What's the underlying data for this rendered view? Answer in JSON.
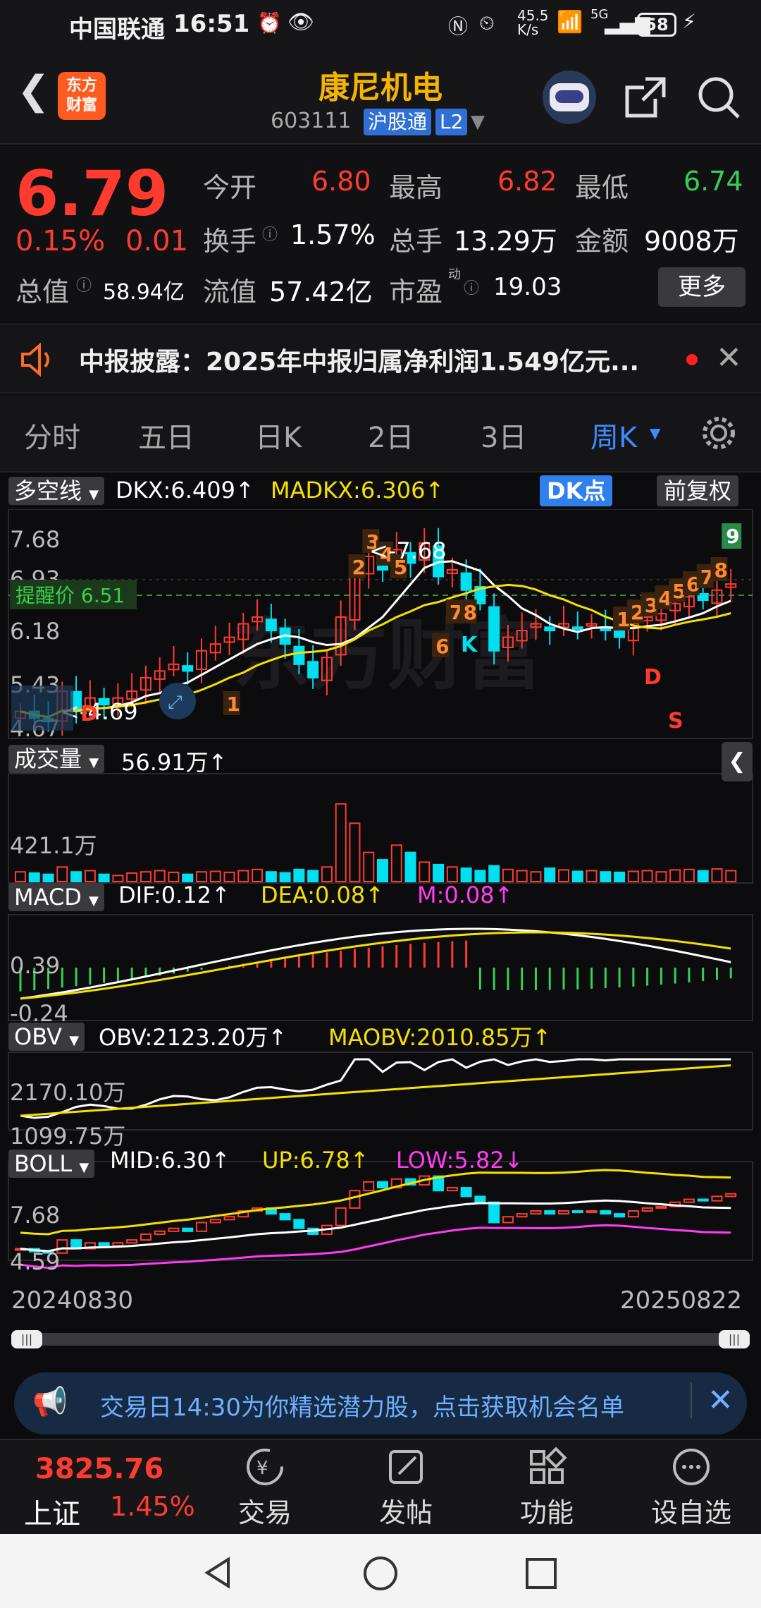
{
  "status": {
    "carrier": "中国联通",
    "time": "16:51",
    "net_speed_top": "45.5",
    "net_speed_unit": "K/s",
    "signal": "5G",
    "battery": "58"
  },
  "header": {
    "logo_line1": "东方",
    "logo_line2": "财富",
    "stock_name": "康尼机电",
    "code": "603111",
    "channel": "沪股通",
    "level": "L2"
  },
  "quote": {
    "price": "6.79",
    "change_pct": "0.15%",
    "change": "0.01",
    "open_label": "今开",
    "open": "6.80",
    "high_label": "最高",
    "high": "6.82",
    "low_label": "最低",
    "low": "6.74",
    "turnover_label": "换手",
    "turnover": "1.57%",
    "volume_label": "总手",
    "volume": "13.29万",
    "amount_label": "金额",
    "amount": "9008万",
    "mktcap_label": "总值",
    "mktcap": "58.94亿",
    "float_label": "流值",
    "float": "57.42亿",
    "pe_label": "市盈",
    "pe_sup": "动",
    "pe": "19.03",
    "more": "更多"
  },
  "notice": {
    "text": "中报披露：2025年中报归属净利润1.549亿元..."
  },
  "tabs": [
    "分时",
    "五日",
    "日K",
    "2日",
    "3日",
    "周K"
  ],
  "kline": {
    "indicator": "多空线",
    "dkx": "DKX:6.409↑",
    "madkx": "MADKX:6.306↑",
    "dk_btn": "DK点",
    "adj_btn": "前复权",
    "y_labels": [
      "7.68",
      "6.93",
      "6.18",
      "5.43",
      "4.67"
    ],
    "alert": "提醒价 6.51",
    "high_mark": "<-7.68",
    "low_mark": "<-4.69",
    "watermark": "东方财富"
  },
  "volume": {
    "label": "成交量",
    "value": "56.91万↑",
    "max": "421.1万"
  },
  "macd": {
    "label": "MACD",
    "dif": "DIF:0.12↑",
    "dea": "DEA:0.08↑",
    "m": "M:0.08↑",
    "top": "0.39",
    "bottom": "-0.24"
  },
  "obv": {
    "label": "OBV",
    "obv": "OBV:2123.20万↑",
    "maobv": "MAOBV:2010.85万↑",
    "top": "2170.10万",
    "bottom": "1099.75万"
  },
  "boll": {
    "label": "BOLL",
    "mid": "MID:6.30↑",
    "up": "UP:6.78↑",
    "low": "LOW:5.82↓",
    "top": "7.68",
    "bottom": "4.59"
  },
  "dates": {
    "start": "20240830",
    "end": "20250822"
  },
  "ad": {
    "text": "交易日14:30为你精选潜力股，点击获取机会名单"
  },
  "bottomnav": {
    "index_value": "3825.76",
    "index_name": "上证",
    "index_pct": "1.45%",
    "trade": "交易",
    "post": "发帖",
    "func": "功能",
    "watch": "设自选"
  },
  "colors": {
    "up": "#ff3b30",
    "down": "#00e0f0",
    "accent": "#2f80ed",
    "yellow": "#f5e000",
    "magenta": "#ff3cf3"
  }
}
